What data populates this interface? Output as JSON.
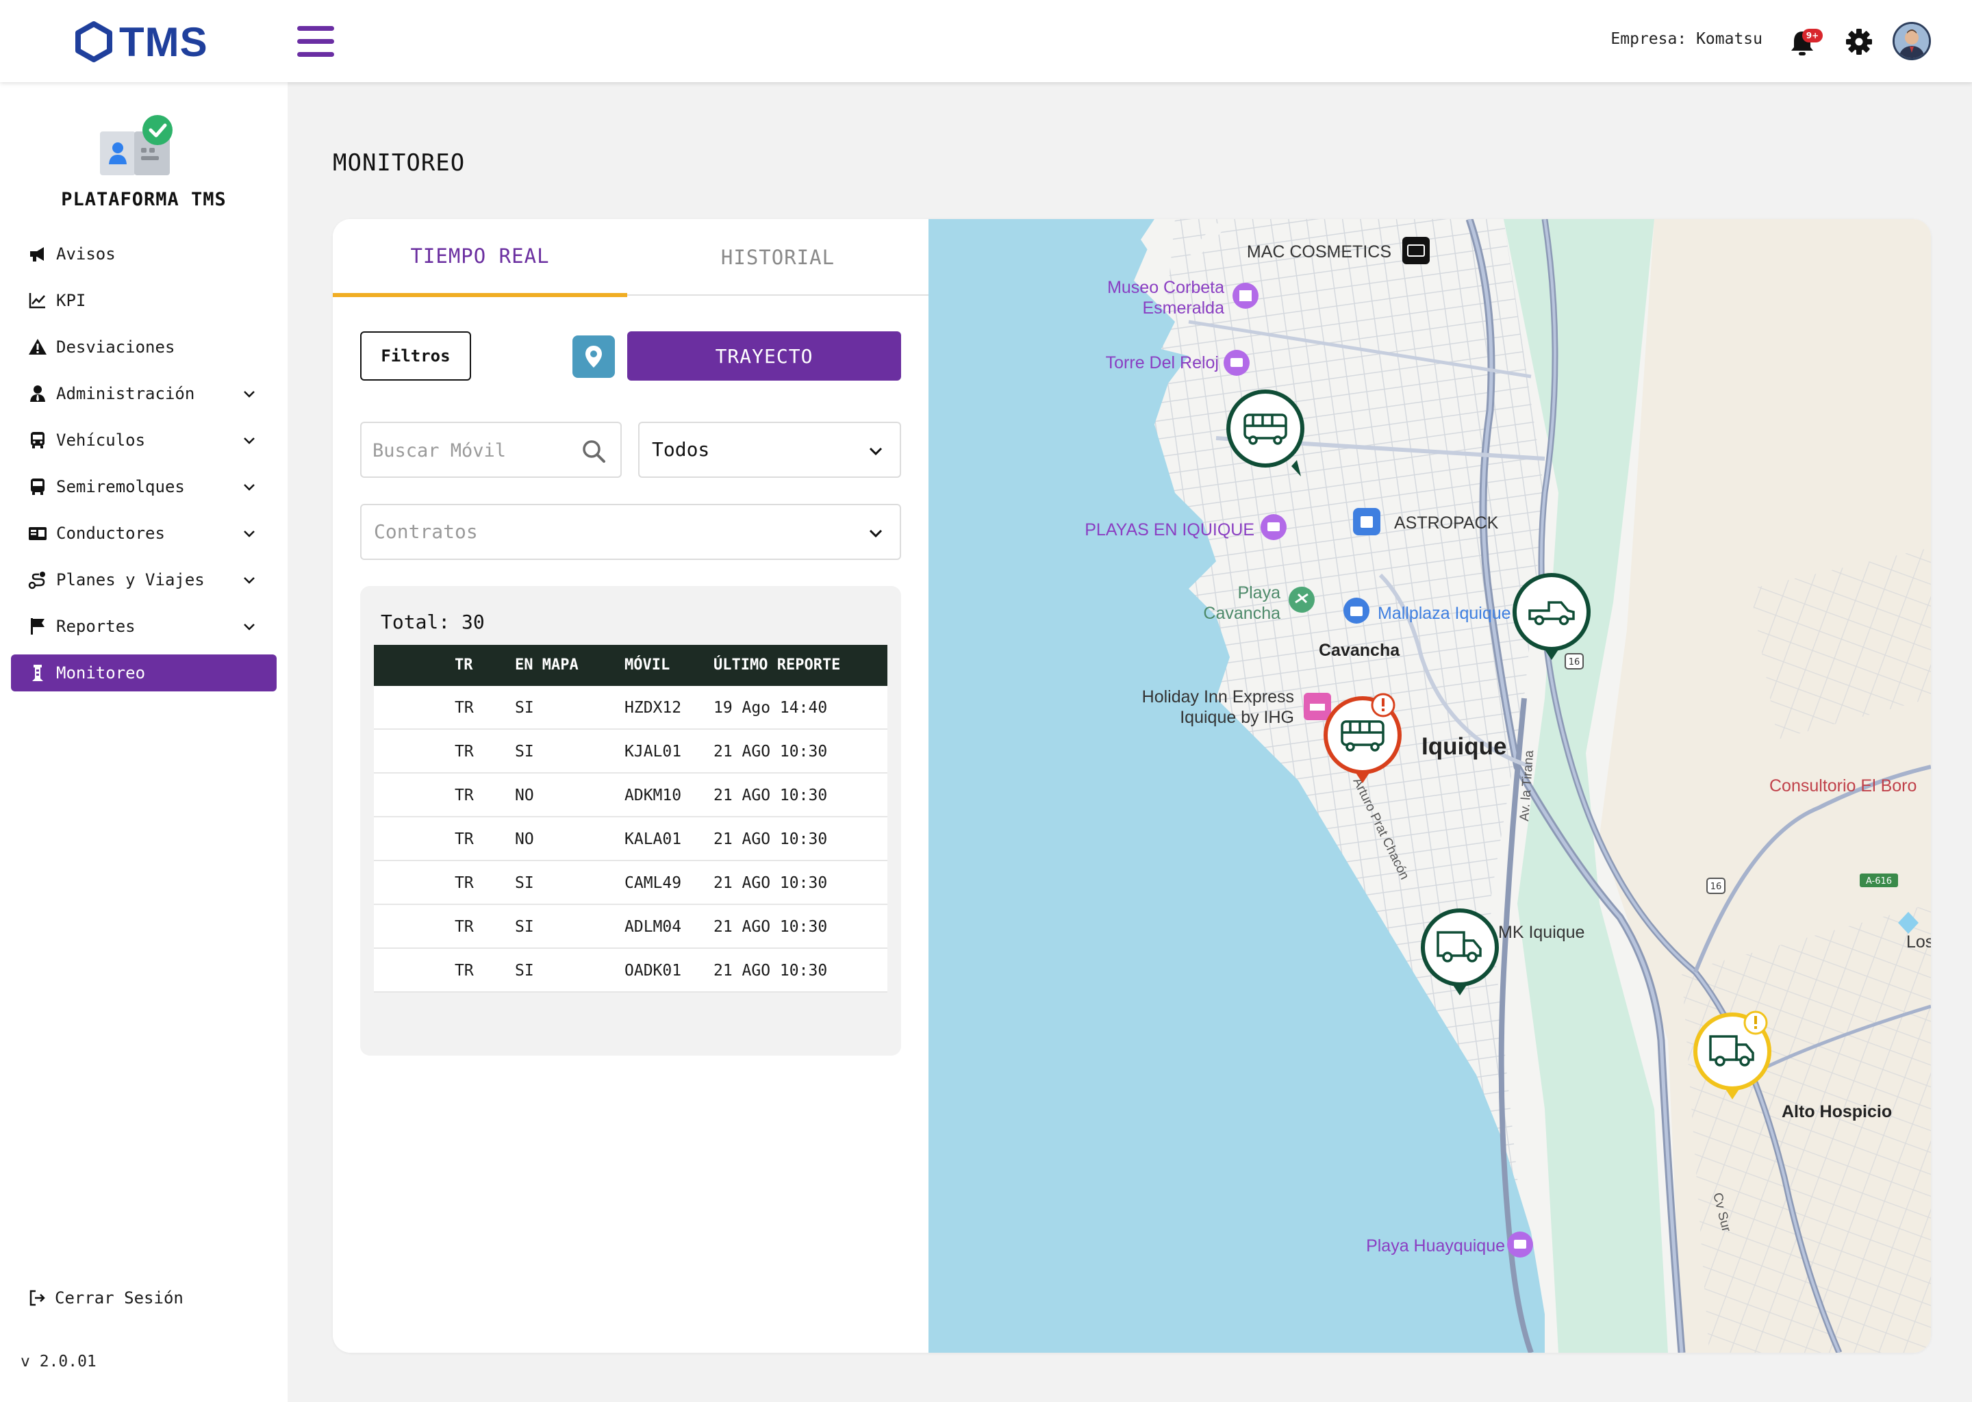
{
  "app": {
    "logo_text": "TMS"
  },
  "header": {
    "company_label": "Empresa:",
    "company_name": "Komatsu",
    "notification_count": "9+"
  },
  "sidebar": {
    "title": "PLATAFORMA TMS",
    "items": [
      {
        "label": "Avisos",
        "icon": "megaphone-icon",
        "expandable": false
      },
      {
        "label": "KPI",
        "icon": "chart-line-icon",
        "expandable": false
      },
      {
        "label": "Desviaciones",
        "icon": "warning-icon",
        "expandable": false
      },
      {
        "label": "Administración",
        "icon": "user-tie-icon",
        "expandable": true
      },
      {
        "label": "Vehículos",
        "icon": "bus-icon",
        "expandable": true
      },
      {
        "label": "Semiremolques",
        "icon": "trailer-icon",
        "expandable": true
      },
      {
        "label": "Conductores",
        "icon": "id-card-icon",
        "expandable": true
      },
      {
        "label": "Planes y Viajes",
        "icon": "route-icon",
        "expandable": true
      },
      {
        "label": "Reportes",
        "icon": "flag-icon",
        "expandable": true
      },
      {
        "label": "Monitoreo",
        "icon": "tower-icon",
        "expandable": false,
        "active": true
      }
    ],
    "logout_label": "Cerrar Sesión",
    "version": "v 2.0.01"
  },
  "main": {
    "page_title": "MONITOREO",
    "tabs": [
      {
        "label": "TIEMPO REAL",
        "active": true
      },
      {
        "label": "HISTORIAL",
        "active": false
      }
    ],
    "filters_button": "Filtros",
    "route_button": "TRAYECTO",
    "search_placeholder": "Buscar Móvil",
    "status_select": "Todos",
    "contracts_placeholder": "Contratos",
    "total_label": "Total:",
    "total_value": "30",
    "table": {
      "columns": [
        "TR",
        "EN MAPA",
        "MÓVIL",
        "ÚLTIMO REPORTE"
      ],
      "rows": [
        [
          "TR",
          "SI",
          "HZDX12",
          "19 Ago 14:40"
        ],
        [
          "TR",
          "SI",
          "KJAL01",
          "21 AGO 10:30"
        ],
        [
          "TR",
          "NO",
          "ADKM10",
          "21 AGO 10:30"
        ],
        [
          "TR",
          "NO",
          "KALA01",
          "21 AGO 10:30"
        ],
        [
          "TR",
          "SI",
          "CAML49",
          "21 AGO 10:30"
        ],
        [
          "TR",
          "SI",
          "ADLM04",
          "21 AGO 10:30"
        ],
        [
          "TR",
          "SI",
          "OADK01",
          "21 AGO 10:30"
        ]
      ]
    }
  },
  "map": {
    "labels": {
      "mac": "MAC COSMETICS",
      "museo_1": "Museo Corbeta",
      "museo_2": "Esmeralda",
      "torre": "Torre Del Reloj",
      "playas": "PLAYAS EN IQUIQUE",
      "astropack": "ASTROPACK",
      "playa_1": "Playa",
      "playa_2": "Cavancha",
      "mallplaza": "Mallplaza Iquique",
      "cavancha": "Cavancha",
      "holiday_1": "Holiday Inn Express",
      "holiday_2": "Iquique by IHG",
      "iquique": "Iquique",
      "tirana": "Av. la Tirana",
      "prat": "Arturo Prat Chacón",
      "consultorio": "Consultorio El Boro",
      "mk": "MK Iquique",
      "alto": "Alto Hospicio",
      "cvsur": "Cv Sur",
      "huayquique": "Playa Huayquique",
      "los": "Los",
      "r16a": "16",
      "r16b": "16",
      "a616": "A-616"
    },
    "markers": [
      {
        "vehicle": "bus",
        "status": "ok"
      },
      {
        "vehicle": "pickup",
        "status": "ok"
      },
      {
        "vehicle": "bus",
        "status": "alert"
      },
      {
        "vehicle": "truck",
        "status": "ok"
      },
      {
        "vehicle": "truck",
        "status": "warning"
      }
    ]
  },
  "colors": {
    "brand_purple": "#6b2fa0",
    "logo_blue": "#1f3f9c",
    "tab_underline": "#f0ad23",
    "marker_ok": "#0f4d36",
    "marker_alert": "#d8401c",
    "marker_warning": "#f2c31b",
    "sea": "#a6d8ea"
  }
}
